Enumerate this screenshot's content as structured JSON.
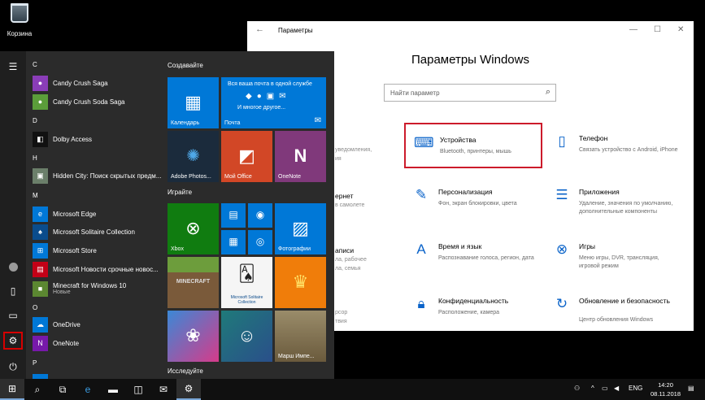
{
  "desktop": {
    "recycle_bin_label": "Корзина"
  },
  "start_menu": {
    "letters": {
      "c": "C",
      "d": "D",
      "h": "H",
      "m": "M",
      "o": "O",
      "p": "P"
    },
    "apps": {
      "candy_crush": "Candy Crush Saga",
      "candy_soda": "Candy Crush Soda Saga",
      "dolby": "Dolby Access",
      "hidden_city": "Hidden City: Поиск скрытых предм...",
      "edge": "Microsoft Edge",
      "solitaire": "Microsoft Solitaire Collection",
      "store": "Microsoft Store",
      "news": "Microsoft Новости срочные новос...",
      "minecraft": "Minecraft for Windows 10",
      "minecraft_badge": "Новые",
      "onedrive": "OneDrive",
      "onenote": "OneNote"
    },
    "groups": {
      "create": "Создавайте",
      "play": "Играйте",
      "explore": "Исследуйте"
    },
    "tiles": {
      "calendar": "Календарь",
      "mail": "Почта",
      "mail_promo": "Вся ваша почта в одной службе",
      "mail_more": "И многое другое...",
      "photoshop": "Adobe Photos...",
      "office": "Мой Office",
      "onenote": "OneNote",
      "xbox": "Xbox",
      "photos": "Фотографии",
      "minecraft_art": "MINECRAFT",
      "solitaire": "Microsoft Solitaire Collection",
      "march": "Марш Импе..."
    }
  },
  "settings": {
    "window_title": "Параметры",
    "heading": "Параметры Windows",
    "search_placeholder": "Найти параметр",
    "categories": {
      "devices_title": "Устройства",
      "devices_desc": "Bluetooth, принтеры, мышь",
      "phone_title": "Телефон",
      "phone_desc": "Связать устройство с Android, iPhone",
      "personal_title": "Персонализация",
      "personal_desc": "Фон, экран блокировки, цвета",
      "apps_title": "Приложения",
      "apps_desc": "Удаление, значения по умолчанию, дополнительные компоненты",
      "time_title": "Время и язык",
      "time_desc": "Распознавание голоса, регион, дата",
      "games_title": "Игры",
      "games_desc": "Меню игры, DVR, трансляция, игровой режим",
      "privacy_title": "Конфиденциальность",
      "privacy_desc": "Расположение, камера",
      "update_title": "Обновление и безопасность",
      "update_desc": "Центр обновления Windows"
    },
    "partial": {
      "r1": "уведомления,",
      "r1b": "ия",
      "r2_title": "ернет",
      "r2a": "в самолете",
      "r3_title": "аписи",
      "r3a": "ла, рабочее",
      "r3b": "ла, семья",
      "r4a": "рсор",
      "r4b": "твия"
    }
  },
  "taskbar": {
    "lang": "ENG",
    "time": "14:20",
    "date": "08.11.2018"
  },
  "colors": {
    "accent_blue": "#0078d7",
    "selection_red": "#cc1b2b",
    "start_bg": "#2b2b2b",
    "taskbar_bg": "#101010"
  }
}
